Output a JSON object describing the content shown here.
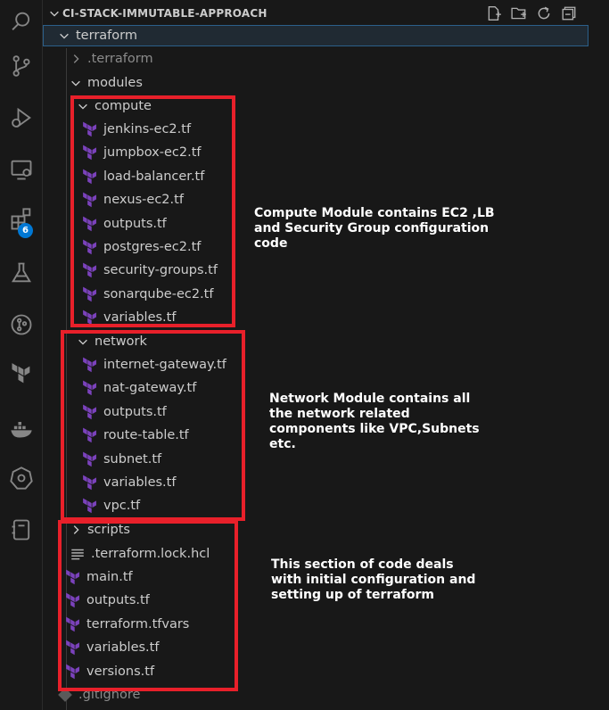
{
  "explorer": {
    "project_title": "CI-STACK-IMMUTABLE-APPROACH",
    "header_actions": [
      "new-file-icon",
      "new-folder-icon",
      "refresh-icon",
      "collapse-all-icon"
    ]
  },
  "activity_bar": {
    "items": [
      "search-icon",
      "source-control-icon",
      "run-debug-icon",
      "remote-explorer-icon",
      "extensions-icon",
      "testing-icon",
      "git-graph-icon",
      "terraform-icon",
      "docker-icon",
      "kubernetes-icon",
      "notebook-icon"
    ],
    "extensions_badge": "6"
  },
  "tree": {
    "terraform": "terraform",
    "dot_terraform": ".terraform",
    "modules": "modules",
    "compute": {
      "label": "compute",
      "files": [
        "jenkins-ec2.tf",
        "jumpbox-ec2.tf",
        "load-balancer.tf",
        "nexus-ec2.tf",
        "outputs.tf",
        "postgres-ec2.tf",
        "security-groups.tf",
        "sonarqube-ec2.tf",
        "variables.tf"
      ]
    },
    "network": {
      "label": "network",
      "files": [
        "internet-gateway.tf",
        "nat-gateway.tf",
        "outputs.tf",
        "route-table.tf",
        "subnet.tf",
        "variables.tf",
        "vpc.tf"
      ]
    },
    "scripts": "scripts",
    "lock_file": ".terraform.lock.hcl",
    "root_files": [
      "main.tf",
      "outputs.tf",
      "terraform.tfvars",
      "variables.tf",
      "versions.tf"
    ],
    "gitignore": ".gitignore"
  },
  "annotations": {
    "compute_note": "Compute Module contains EC2 ,LB\nand Security Group configuration\ncode",
    "network_note": "Network Module contains all\nthe network related\ncomponents like VPC,Subnets\netc.",
    "root_note": "This section of code deals\nwith initial configuration and\nsetting up of terraform"
  },
  "colors": {
    "background": "#181818",
    "annotation_box": "#e8202a",
    "terraform_icon": "#7b42bc",
    "badge": "#0078d4"
  }
}
